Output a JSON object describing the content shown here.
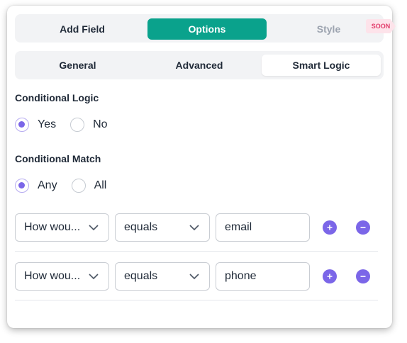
{
  "top_tabs": {
    "add_field": "Add Field",
    "options": "Options",
    "style": "Style",
    "soon_badge": "SOON"
  },
  "sub_tabs": {
    "general": "General",
    "advanced": "Advanced",
    "smart_logic": "Smart Logic"
  },
  "conditional_logic": {
    "label": "Conditional Logic",
    "options": [
      "Yes",
      "No"
    ],
    "selected": "Yes"
  },
  "conditional_match": {
    "label": "Conditional Match",
    "options": [
      "Any",
      "All"
    ],
    "selected": "Any"
  },
  "rules": [
    {
      "field": "How wou...",
      "operator": "equals",
      "value": "email"
    },
    {
      "field": "How wou...",
      "operator": "equals",
      "value": "phone"
    }
  ],
  "colors": {
    "accent": "#0aa28c",
    "radio": "#7b66e8",
    "badge_bg": "#fde3ea",
    "badge_text": "#e23d6b"
  },
  "icons": {
    "select_arrow": "chevron-down-icon",
    "add_rule": "plus-icon",
    "remove_rule": "minus-icon"
  }
}
